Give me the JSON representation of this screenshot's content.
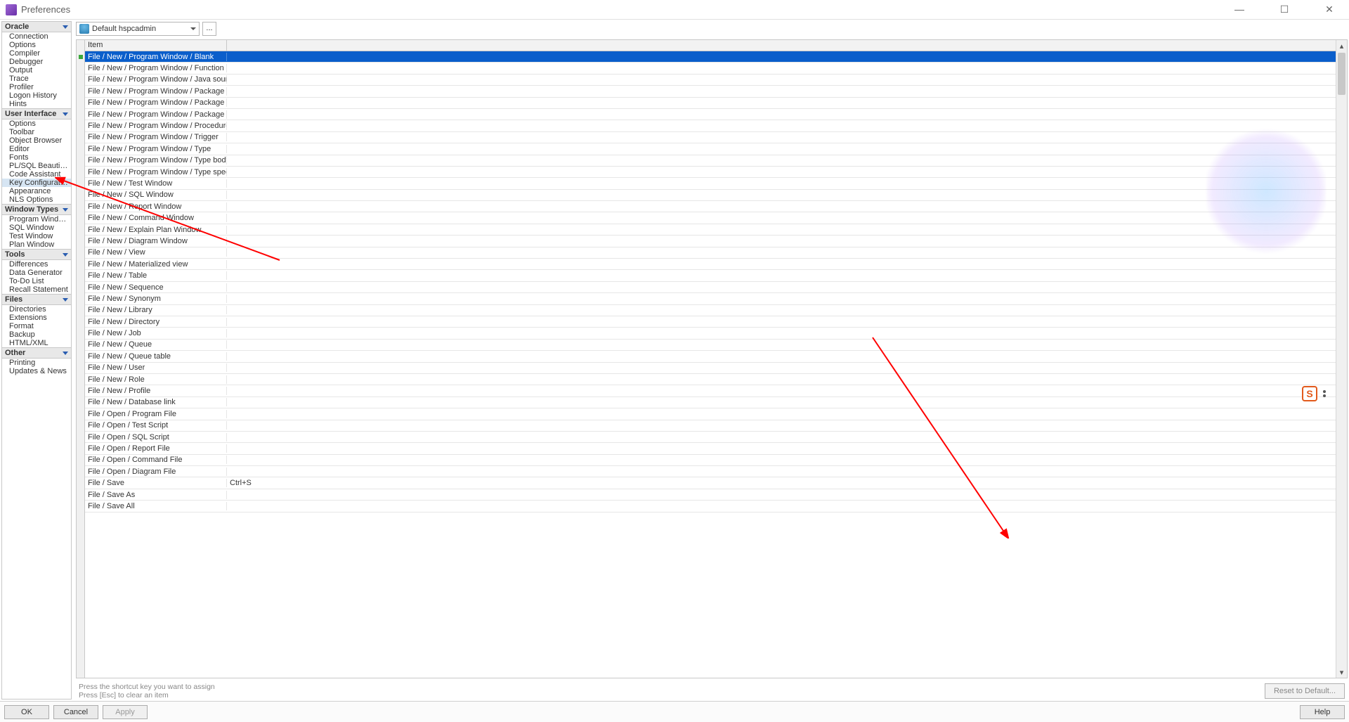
{
  "window": {
    "title": "Preferences"
  },
  "win_controls": {
    "min": "—",
    "max": "☐",
    "close": "✕"
  },
  "preset": {
    "label": "Default hspcadmin",
    "more": "..."
  },
  "sidebar": {
    "groups": [
      {
        "title": "Oracle",
        "items": [
          "Connection",
          "Options",
          "Compiler",
          "Debugger",
          "Output",
          "Trace",
          "Profiler",
          "Logon History",
          "Hints"
        ]
      },
      {
        "title": "User Interface",
        "items": [
          "Options",
          "Toolbar",
          "Object Browser",
          "Editor",
          "Fonts",
          "PL/SQL Beautifier",
          "Code Assistant",
          "Key Configuration",
          "Appearance",
          "NLS Options"
        ],
        "selected": "Key Configuration"
      },
      {
        "title": "Window Types",
        "items": [
          "Program Window",
          "SQL Window",
          "Test Window",
          "Plan Window"
        ]
      },
      {
        "title": "Tools",
        "items": [
          "Differences",
          "Data Generator",
          "To-Do List",
          "Recall Statement"
        ]
      },
      {
        "title": "Files",
        "items": [
          "Directories",
          "Extensions",
          "Format",
          "Backup",
          "HTML/XML"
        ]
      },
      {
        "title": "Other",
        "items": [
          "Printing",
          "Updates & News"
        ]
      }
    ]
  },
  "table": {
    "col_item": "Item",
    "col_key": "",
    "rows": [
      {
        "item": "File / New / Program Window / Blank",
        "key": "",
        "selected": true
      },
      {
        "item": "File / New / Program Window / Function",
        "key": ""
      },
      {
        "item": "File / New / Program Window / Java source",
        "key": ""
      },
      {
        "item": "File / New / Program Window / Package",
        "key": ""
      },
      {
        "item": "File / New / Program Window / Package body",
        "key": ""
      },
      {
        "item": "File / New / Program Window / Package specificatio",
        "key": ""
      },
      {
        "item": "File / New / Program Window / Procedure",
        "key": ""
      },
      {
        "item": "File / New / Program Window / Trigger",
        "key": ""
      },
      {
        "item": "File / New / Program Window / Type",
        "key": ""
      },
      {
        "item": "File / New / Program Window / Type body",
        "key": ""
      },
      {
        "item": "File / New / Program Window / Type specification",
        "key": ""
      },
      {
        "item": "File / New / Test Window",
        "key": ""
      },
      {
        "item": "File / New / SQL Window",
        "key": ""
      },
      {
        "item": "File / New / Report Window",
        "key": ""
      },
      {
        "item": "File / New / Command Window",
        "key": ""
      },
      {
        "item": "File / New / Explain Plan Window",
        "key": ""
      },
      {
        "item": "File / New / Diagram Window",
        "key": ""
      },
      {
        "item": "File / New / View",
        "key": ""
      },
      {
        "item": "File / New / Materialized view",
        "key": ""
      },
      {
        "item": "File / New / Table",
        "key": ""
      },
      {
        "item": "File / New / Sequence",
        "key": ""
      },
      {
        "item": "File / New / Synonym",
        "key": ""
      },
      {
        "item": "File / New / Library",
        "key": ""
      },
      {
        "item": "File / New / Directory",
        "key": ""
      },
      {
        "item": "File / New / Job",
        "key": ""
      },
      {
        "item": "File / New / Queue",
        "key": ""
      },
      {
        "item": "File / New / Queue table",
        "key": ""
      },
      {
        "item": "File / New / User",
        "key": ""
      },
      {
        "item": "File / New / Role",
        "key": ""
      },
      {
        "item": "File / New / Profile",
        "key": ""
      },
      {
        "item": "File / New / Database link",
        "key": ""
      },
      {
        "item": "File / Open / Program File",
        "key": ""
      },
      {
        "item": "File / Open / Test Script",
        "key": ""
      },
      {
        "item": "File / Open / SQL Script",
        "key": ""
      },
      {
        "item": "File / Open / Report File",
        "key": ""
      },
      {
        "item": "File / Open / Command File",
        "key": ""
      },
      {
        "item": "File / Open / Diagram File",
        "key": ""
      },
      {
        "item": "File / Save",
        "key": "Ctrl+S"
      },
      {
        "item": "File / Save As",
        "key": ""
      },
      {
        "item": "File / Save All",
        "key": ""
      }
    ]
  },
  "hints": {
    "line1": "Press the shortcut key you want to assign",
    "line2": "Press [Esc] to clear an item"
  },
  "buttons": {
    "reset": "Reset to Default...",
    "ok": "OK",
    "cancel": "Cancel",
    "apply": "Apply",
    "help": "Help"
  },
  "ime": {
    "s": "S"
  }
}
